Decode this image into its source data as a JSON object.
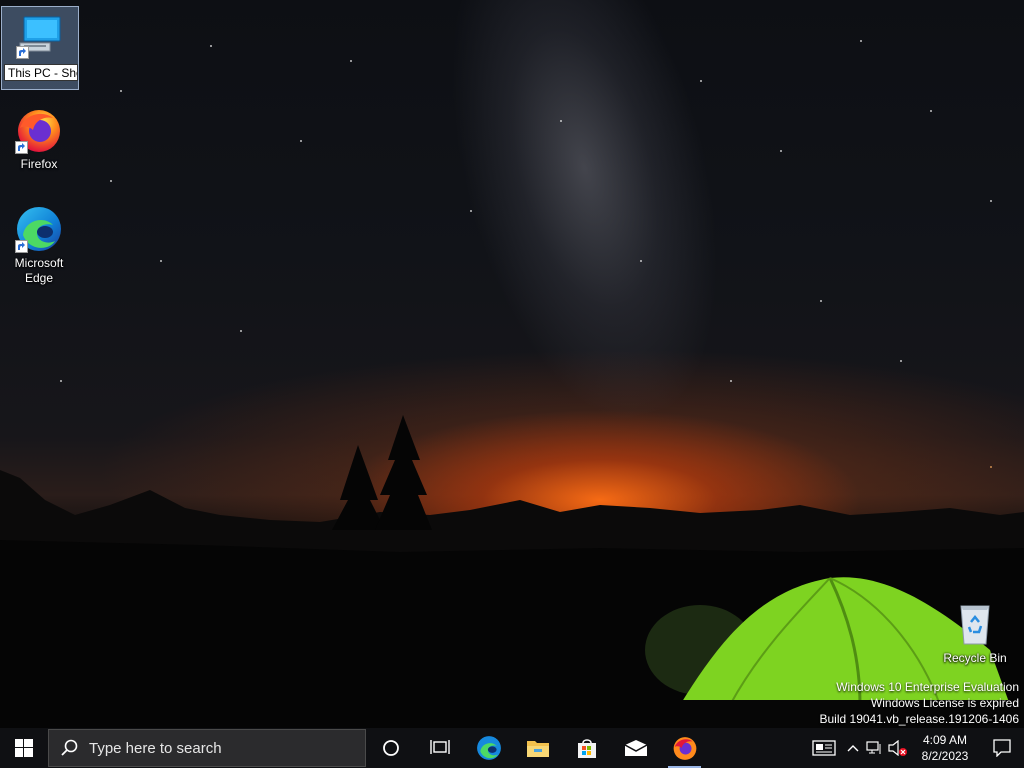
{
  "desktop": {
    "icons": [
      {
        "label": "This PC",
        "rename_text": "This PC - Sho",
        "icon": "computer-icon",
        "selected": true
      },
      {
        "label": "Firefox",
        "icon": "firefox-icon"
      },
      {
        "label": "Microsoft Edge",
        "icon": "edge-icon"
      },
      {
        "label": "Recycle Bin",
        "icon": "recycle-bin-icon"
      }
    ],
    "watermark": {
      "line1": "Windows 10 Enterprise Evaluation",
      "line2": "Windows License is expired",
      "line3": "Build 19041.vb_release.191206-1406"
    }
  },
  "taskbar": {
    "search_placeholder": "Type here to search",
    "apps": [
      {
        "name": "Cortana",
        "icon": "cortana-circle-icon"
      },
      {
        "name": "Task View",
        "icon": "task-view-icon"
      },
      {
        "name": "Microsoft Edge",
        "icon": "edge-icon"
      },
      {
        "name": "File Explorer",
        "icon": "folder-icon"
      },
      {
        "name": "Microsoft Store",
        "icon": "store-bag-icon"
      },
      {
        "name": "Mail",
        "icon": "mail-icon"
      },
      {
        "name": "Firefox",
        "icon": "firefox-icon",
        "running": true
      }
    ],
    "tray": {
      "time": "4:09 AM",
      "date": "8/2/2023"
    }
  },
  "colors": {
    "taskbar": "#0f1013",
    "search_bg": "#2b2b2d",
    "accent": "#9ab6e6"
  }
}
